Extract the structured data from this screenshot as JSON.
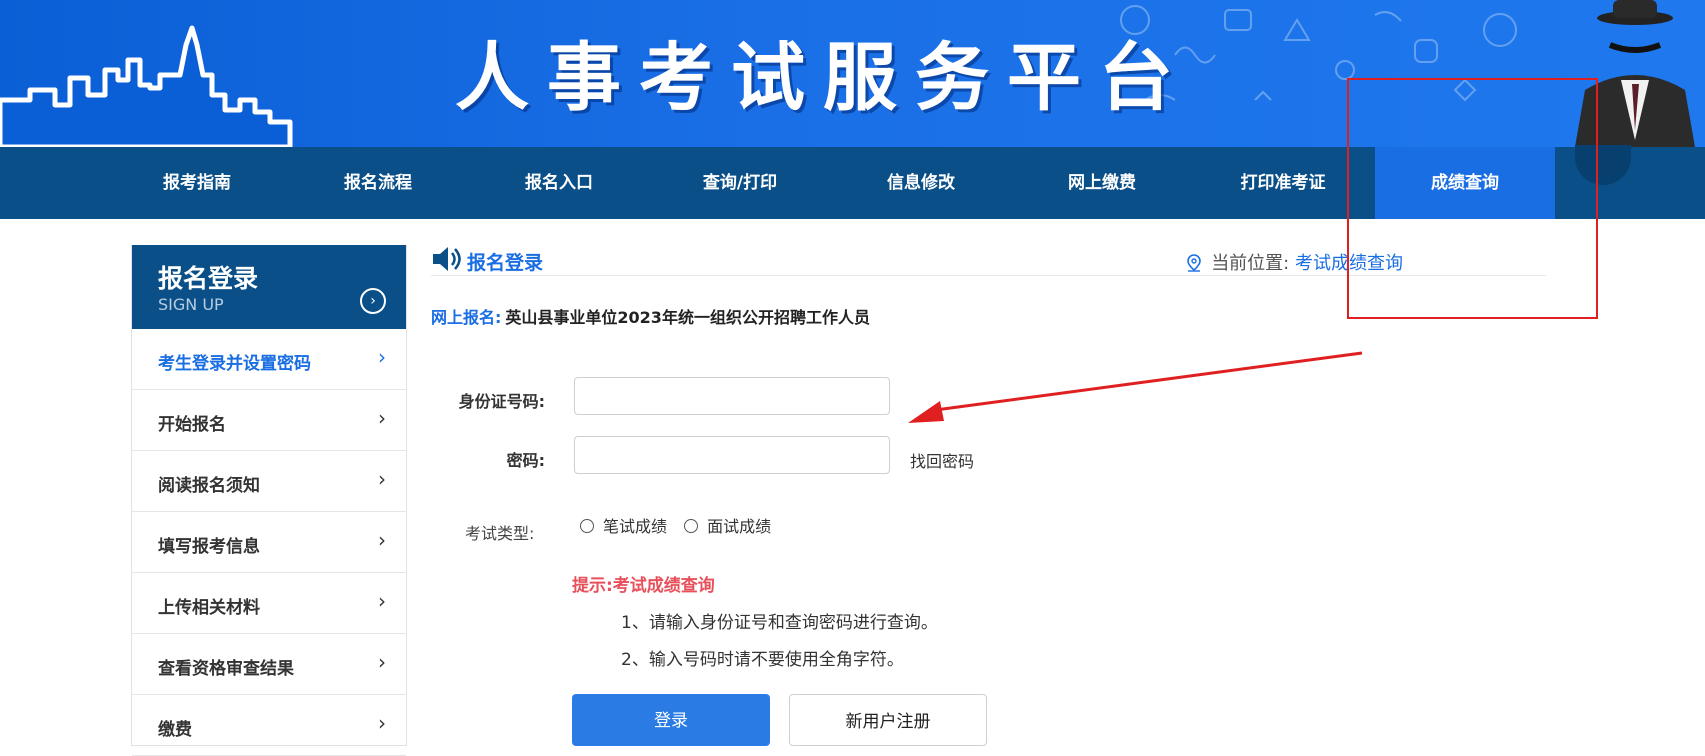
{
  "header": {
    "title": "人事考试服务平台"
  },
  "nav": {
    "items": [
      {
        "label": "报考指南"
      },
      {
        "label": "报名流程"
      },
      {
        "label": "报名入口"
      },
      {
        "label": "查询/打印"
      },
      {
        "label": "信息修改"
      },
      {
        "label": "网上缴费"
      },
      {
        "label": "打印准考证"
      },
      {
        "label": "成绩查询",
        "active": true
      }
    ]
  },
  "sidebar": {
    "title": "报名登录",
    "subtitle": "SIGN UP",
    "items": [
      {
        "label": "考生登录并设置密码",
        "active": true
      },
      {
        "label": "开始报名"
      },
      {
        "label": "阅读报名须知"
      },
      {
        "label": "填写报考信息"
      },
      {
        "label": "上传相关材料"
      },
      {
        "label": "查看资格审查结果"
      },
      {
        "label": "缴费"
      }
    ]
  },
  "main": {
    "section_title": "报名登录",
    "breadcrumb": {
      "prefix": "当前位置:",
      "current": "考试成绩查询"
    },
    "online": {
      "key": "网上报名:",
      "value": "英山县事业单位2023年统一组织公开招聘工作人员"
    },
    "form": {
      "id_label": "身份证号码:",
      "id_value": "",
      "password_label": "密码:",
      "password_value": "",
      "recover_label": "找回密码",
      "exam_type_label": "考试类型:",
      "exam_type_options": [
        "笔试成绩",
        "面试成绩"
      ]
    },
    "tip": {
      "title": "提示:考试成绩查询",
      "lines": [
        "1、请输入身份证号和查询密码进行查询。",
        "2、输入号码时请不要使用全角字符。"
      ]
    },
    "buttons": {
      "login": "登录",
      "register": "新用户注册"
    }
  },
  "colors": {
    "brand_blue": "#1a6ee3",
    "nav_bg": "#0a4f87",
    "tip_red": "#e8505b",
    "annotation_red": "#e02020"
  }
}
